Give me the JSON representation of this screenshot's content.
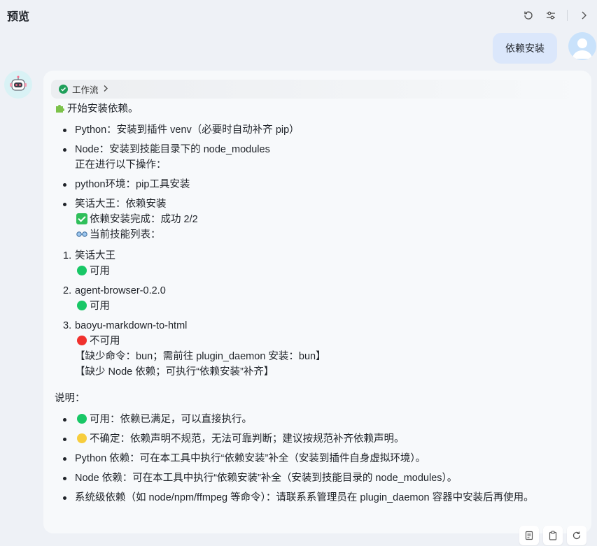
{
  "header": {
    "title": "预览"
  },
  "user_message": {
    "text": "依赖安装"
  },
  "assistant": {
    "workflow_label": "工作流",
    "intro": "开始安装依赖。",
    "list1": [
      "Python：安装到插件 venv（必要时自动补齐 pip）",
      "Node：安装到技能目录下的 node_modules",
      "正在进行以下操作：",
      "python环境：pip工具安装",
      "笑话大王：依赖安装",
      "依赖安装完成：成功 2/2",
      "当前技能列表："
    ],
    "skills": [
      {
        "num": "1.",
        "name": "笑话大王",
        "status": "可用"
      },
      {
        "num": "2.",
        "name": "agent-browser-0.2.0",
        "status": "可用"
      },
      {
        "num": "3.",
        "name": "baoyu-markdown-to-html",
        "status": "不可用",
        "notes": [
          "【缺少命令：bun；需前往 plugin_daemon 安装：bun】",
          "【缺少 Node 依赖；可执行“依赖安装”补齐】"
        ]
      }
    ],
    "explain_label": "说明：",
    "explain": [
      "可用：依赖已满足，可以直接执行。",
      "不确定：依赖声明不规范，无法可靠判断；建议按规范补齐依赖声明。",
      "Python 依赖：可在本工具中执行“依赖安装”补全（安装到插件自身虚拟环境）。",
      "Node 依赖：可在本工具中执行“依赖安装”补全（安装到技能目录的 node_modules）。",
      "系统级依赖（如 node/npm/ffmpeg 等命令）：请联系系管理员在 plugin_daemon 容器中安装后再使用。"
    ]
  },
  "colors": {
    "status_ok": "#18c766",
    "status_fail": "#f0312d",
    "status_unknown": "#f7cd3d",
    "user_bubble": "#dbe7fb"
  }
}
